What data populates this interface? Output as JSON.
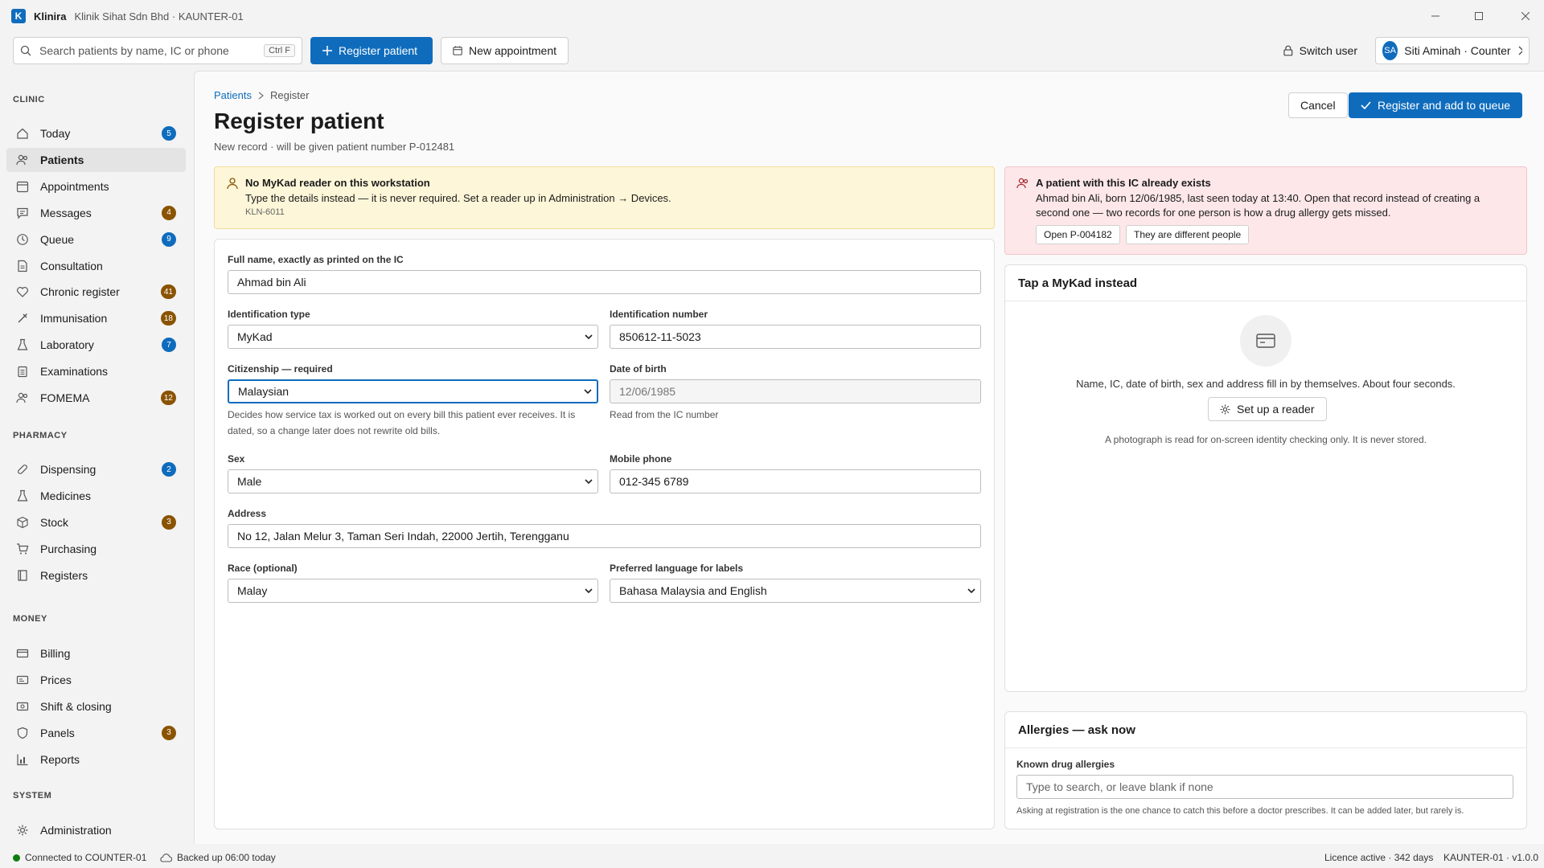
{
  "titlebar": {
    "logo": "K",
    "app_name": "Klinira",
    "context": "Klinik Sihat Sdn Bhd · KAUNTER-01"
  },
  "toolbar": {
    "search_placeholder": "Search patients by name, IC or phone",
    "search_shortcut": "Ctrl F",
    "register_label": "Register patient",
    "appointment_label": "New appointment",
    "switch_user_label": "Switch user",
    "user_initials": "SA",
    "user_label": "Siti Aminah · Counter"
  },
  "sidebar": {
    "sections": [
      "CLINIC",
      "PHARMACY",
      "MONEY",
      "SYSTEM"
    ],
    "clinic": [
      {
        "label": "Today",
        "badge": "5",
        "badge_color": "#0f6cbd",
        "icon": "home-icon"
      },
      {
        "label": "Patients",
        "badge": "",
        "icon": "people-icon",
        "active": true
      },
      {
        "label": "Appointments",
        "badge": "",
        "icon": "calendar-icon"
      },
      {
        "label": "Messages",
        "badge": "4",
        "badge_color": "#8a5300",
        "icon": "chat-icon"
      },
      {
        "label": "Queue",
        "badge": "9",
        "badge_color": "#0f6cbd",
        "icon": "clock-icon"
      },
      {
        "label": "Consultation",
        "badge": "",
        "icon": "document-icon"
      },
      {
        "label": "Chronic register",
        "badge": "41",
        "badge_color": "#8a5300",
        "icon": "heart-icon"
      },
      {
        "label": "Immunisation",
        "badge": "18",
        "badge_color": "#8a5300",
        "icon": "syringe-icon"
      },
      {
        "label": "Laboratory",
        "badge": "7",
        "badge_color": "#0f6cbd",
        "icon": "flask-icon"
      },
      {
        "label": "Examinations",
        "badge": "",
        "icon": "clipboard-icon"
      },
      {
        "label": "FOMEMA",
        "badge": "12",
        "badge_color": "#8a5300",
        "icon": "people-icon"
      }
    ],
    "pharmacy": [
      {
        "label": "Dispensing",
        "badge": "2",
        "badge_color": "#0f6cbd",
        "icon": "pill-icon"
      },
      {
        "label": "Medicines",
        "badge": "",
        "icon": "flask-icon"
      },
      {
        "label": "Stock",
        "badge": "3",
        "badge_color": "#8a5300",
        "icon": "box-icon"
      },
      {
        "label": "Purchasing",
        "badge": "",
        "icon": "cart-icon"
      },
      {
        "label": "Registers",
        "badge": "",
        "icon": "book-icon"
      }
    ],
    "money": [
      {
        "label": "Billing",
        "badge": "",
        "icon": "card-icon"
      },
      {
        "label": "Prices",
        "badge": "",
        "icon": "tag-icon"
      },
      {
        "label": "Shift & closing",
        "badge": "",
        "icon": "cash-icon"
      },
      {
        "label": "Panels",
        "badge": "3",
        "badge_color": "#8a5300",
        "icon": "shield-icon"
      },
      {
        "label": "Reports",
        "badge": "",
        "icon": "chart-icon"
      }
    ],
    "system": [
      {
        "label": "Administration",
        "badge": "",
        "icon": "gear-icon"
      }
    ]
  },
  "page": {
    "crumb_root": "Patients",
    "crumb_current": "Register",
    "title": "Register patient",
    "subtitle": "New record · will be given patient number P-012481",
    "cancel_label": "Cancel",
    "submit_label": "Register and add to queue"
  },
  "warning": {
    "title": "No MyKad reader on this workstation",
    "text": "Type the details instead — it is never required. Set a reader up in Administration → Devices.",
    "code": "KLN-6011"
  },
  "duplicate": {
    "title": "A patient with this IC already exists",
    "text_line1": "Ahmad bin Ali, born 12/06/1985, last seen today at 13:40. Open that record instead of creating a",
    "text_line2": "second one — two records for one person is how a drug allergy gets missed.",
    "open_label": "Open P-004182",
    "different_label": "They are different people"
  },
  "form": {
    "full_name_label": "Full name, exactly as printed on the IC",
    "full_name": "Ahmad bin Ali",
    "id_type_label": "Identification type",
    "id_type": "MyKad",
    "id_number_label": "Identification number",
    "id_number": "850612-11-5023",
    "citizenship_label": "Citizenship — required",
    "citizenship": "Malaysian",
    "citizenship_hint_1": "Decides how service tax is worked out on every bill this patient ever receives. It is",
    "citizenship_hint_2": "dated, so a change later does not rewrite old bills.",
    "dob_label": "Date of birth",
    "dob": "12/06/1985",
    "dob_hint": "Read from the IC number",
    "sex_label": "Sex",
    "sex": "Male",
    "mobile_label": "Mobile phone",
    "mobile": "012-345 6789",
    "address_label": "Address",
    "address": "No 12, Jalan Melur 3, Taman Seri Indah, 22000 Jertih, Terengganu",
    "race_label": "Race (optional)",
    "race": "Malay",
    "language_label": "Preferred language for labels",
    "language": "Bahasa Malaysia and English"
  },
  "mykad": {
    "title": "Tap a MyKad instead",
    "text": "Name, IC, date of birth, sex and address fill in by themselves. About four seconds.",
    "setup_label": "Set up a reader",
    "note": "A photograph is read for on-screen identity checking only. It is never stored."
  },
  "allergies": {
    "title": "Allergies — ask now",
    "label": "Known drug allergies",
    "placeholder": "Type to search, or leave blank if none",
    "note": "Asking at registration is the one chance to catch this before a doctor prescribes. It can be added later, but rarely is."
  },
  "status": {
    "connection": "Connected to COUNTER-01",
    "backup": "Backed up 06:00 today",
    "licence": "Licence active · 342 days",
    "version": "KAUNTER-01 · v1.0.0"
  },
  "colors": {
    "accent": "#0f6cbd",
    "warning_bg": "#fdf6d8",
    "error_bg": "#fde7e9",
    "badge_brown": "#8a5300",
    "online": "#107c10"
  }
}
